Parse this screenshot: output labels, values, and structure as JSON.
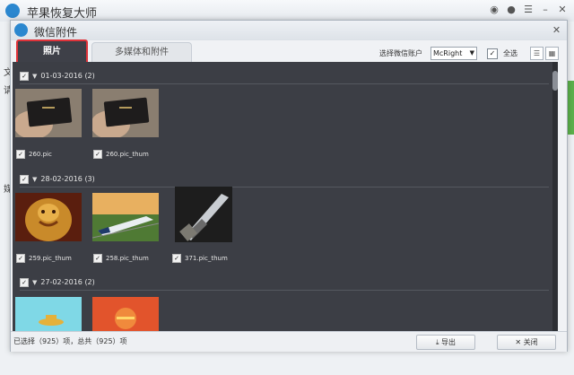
{
  "app": {
    "title": "苹果恢复大师"
  },
  "underlay": {
    "letters": [
      "文",
      "请",
      "媒"
    ]
  },
  "dialog": {
    "title": "微信附件",
    "tabs": [
      {
        "label": "照片",
        "active": true
      },
      {
        "label": "多媒体和附件",
        "active": false
      }
    ],
    "account_label": "选择微信账户",
    "account_value": "McRight",
    "select_all_label": "全选",
    "select_all_checked": true,
    "groups": [
      {
        "date": "01-03-2016",
        "count": "(2)",
        "items": [
          {
            "name": "260.pic",
            "checked": true,
            "thumb": "wallet-photo"
          },
          {
            "name": "260.pic_thum",
            "checked": true,
            "thumb": "wallet-photo"
          }
        ]
      },
      {
        "date": "28-02-2016",
        "count": "(3)",
        "items": [
          {
            "name": "259.pic_thum",
            "checked": true,
            "thumb": "golden-statue-photo"
          },
          {
            "name": "258.pic_thum",
            "checked": true,
            "thumb": "train-photo"
          },
          {
            "name": "371.pic_thum",
            "checked": true,
            "thumb": "knife-photo"
          }
        ]
      },
      {
        "date": "27-02-2016",
        "count": "(2)",
        "items": [
          {
            "name": "",
            "checked": false,
            "thumb": "cyan-graphic"
          },
          {
            "name": "",
            "checked": false,
            "thumb": "red-graphic"
          }
        ]
      }
    ],
    "status": "已选择（925）项，总共（925）项",
    "buttons": {
      "export": "导出",
      "close": "关闭"
    }
  },
  "colors": {
    "accent_red": "#e0333a",
    "panel_dark": "#3c3e45",
    "brand_blue": "#2b87cf"
  }
}
